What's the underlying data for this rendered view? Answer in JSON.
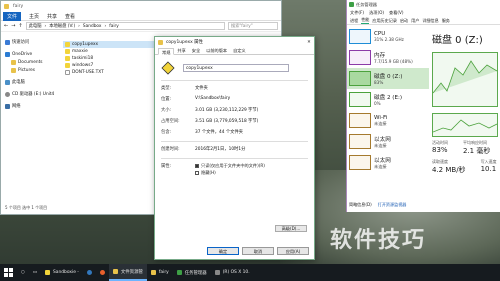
{
  "watermark": "软件技巧",
  "explorer": {
    "title": "fairy",
    "ribbon": [
      "文件",
      "主页",
      "共享",
      "查看"
    ],
    "breadcrumb": [
      "此电脑",
      "本地磁盘 (V:)",
      "Sandbox",
      "fairy"
    ],
    "search_placeholder": "搜索\"fairy\"",
    "nav": [
      {
        "label": "快速访问",
        "icon": "star-icon",
        "sub": false
      },
      {
        "label": "OneDrive",
        "icon": "cloud-icon",
        "sub": false
      },
      {
        "label": "Documents",
        "icon": "folder-icon",
        "sub": true
      },
      {
        "label": "Pictures",
        "icon": "folder-icon",
        "sub": true
      },
      {
        "label": "此电脑",
        "icon": "computer-icon",
        "sub": false
      },
      {
        "label": "CD 驱动器 (E:) Unit4",
        "icon": "disc-icon",
        "sub": false
      },
      {
        "label": "网络",
        "icon": "network-icon",
        "sub": false
      }
    ],
    "files": [
      {
        "name": "copy1upexx",
        "icon": "sandboxie-icon",
        "selected": true
      },
      {
        "name": "maxxie",
        "icon": "sandboxie-icon",
        "selected": false
      },
      {
        "name": "taskimi18",
        "icon": "sandboxie-icon",
        "selected": false
      },
      {
        "name": "windows7",
        "icon": "sandboxie-icon",
        "selected": false
      },
      {
        "name": "DONT-USE.TXT",
        "icon": "text-file-icon",
        "selected": false
      }
    ],
    "status": "5 个项目    选中 1 个项目"
  },
  "properties": {
    "title": "copy1upexx 属性",
    "tabs": [
      "常规",
      "共享",
      "安全",
      "以前的版本",
      "自定义"
    ],
    "name_value": "copy1upexx",
    "rows1": [
      {
        "k": "类型:",
        "v": "文件夹"
      },
      {
        "k": "位置:",
        "v": "V:\\Sandbox\\fairy"
      },
      {
        "k": "大小:",
        "v": "3.01 GB (3,230,112,229 字节)"
      },
      {
        "k": "占用空间:",
        "v": "3.51 GB (3,779,059,518 字节)"
      },
      {
        "k": "包含:",
        "v": "37 个文件，44 个文件夹"
      }
    ],
    "created": {
      "k": "创建时间:",
      "v": "2016年2月1日，10时1分"
    },
    "attr_label": "属性:",
    "attr_readonly": "只读(仅应用于文件夹中的文件)(R)",
    "attr_hidden": "隐藏(H)",
    "advanced": "高级(D)...",
    "ok": "确定",
    "cancel": "取消",
    "apply": "应用(A)"
  },
  "taskmgr": {
    "title": "任务管理器",
    "menu": [
      "文件(F)",
      "选项(O)",
      "查看(V)"
    ],
    "tabs": [
      "进程",
      "性能",
      "应用历史记录",
      "启动",
      "用户",
      "详细信息",
      "服务"
    ],
    "side": [
      {
        "label": "CPU",
        "sub": "31% 2.38 GHz",
        "color": "#1f8dd6",
        "selected": false
      },
      {
        "label": "内存",
        "sub": "7.7/15.9 GB (48%)",
        "color": "#8b3ba8",
        "selected": false
      },
      {
        "label": "磁盘 0 (Z:)",
        "sub": "83%",
        "color": "#4ca23d",
        "selected": true
      },
      {
        "label": "磁盘 2 (E:)",
        "sub": "0%",
        "color": "#4ca23d",
        "selected": false
      },
      {
        "label": "Wi-Fi",
        "sub": "未连接",
        "color": "#a57a2e",
        "selected": false
      },
      {
        "label": "以太网",
        "sub": "未连接",
        "color": "#a57a2e",
        "selected": false
      },
      {
        "label": "以太网",
        "sub": "未连接",
        "color": "#a57a2e",
        "selected": false
      }
    ],
    "main_title": "磁盘 0 (Z:)",
    "active_time_label": "活动时间",
    "active_time_value": "83%",
    "avg_resp_label": "平均响应时间",
    "avg_resp_value": "2.1 毫秒",
    "read_label": "读取速度",
    "read_value": "4.2 MB/秒",
    "write_label": "写入速度",
    "write_value": "10.1",
    "footer_less": "简略信息(D)",
    "footer_link": "打开资源监视器"
  },
  "taskbar": {
    "items": [
      {
        "label": "",
        "icon": "search-icon"
      },
      {
        "label": "",
        "icon": "task-view-icon"
      },
      {
        "label": "Sandboxie -",
        "icon": "sandboxie-icon",
        "active": false
      },
      {
        "label": "",
        "icon": "edge-icon"
      },
      {
        "label": "",
        "icon": "firefox-icon"
      },
      {
        "label": "文件资源管",
        "icon": "folder-icon",
        "active": true
      },
      {
        "label": "fairy",
        "icon": "folder-icon",
        "active": false
      },
      {
        "label": "任务管理器",
        "icon": "taskmgr-icon",
        "active": false
      },
      {
        "label": "(R) OS X 10.",
        "icon": "vm-icon",
        "active": false
      }
    ]
  }
}
